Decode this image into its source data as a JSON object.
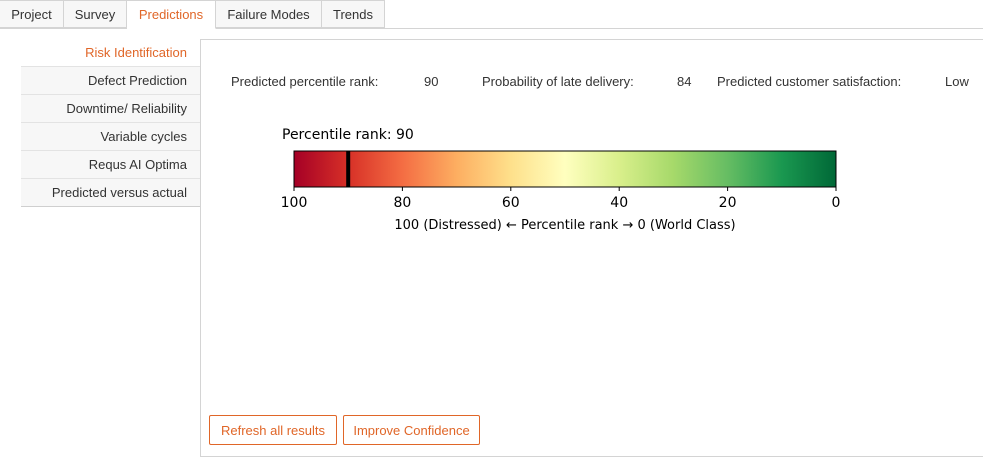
{
  "tabs": [
    {
      "label": "Project"
    },
    {
      "label": "Survey"
    },
    {
      "label": "Predictions"
    },
    {
      "label": "Failure Modes"
    },
    {
      "label": "Trends"
    }
  ],
  "active_tab": "Predictions",
  "sidebar": {
    "items": [
      {
        "label": "Risk Identification"
      },
      {
        "label": "Defect Prediction"
      },
      {
        "label": "Downtime/ Reliability"
      },
      {
        "label": "Variable cycles"
      },
      {
        "label": "Requs AI Optima"
      },
      {
        "label": "Predicted versus actual"
      }
    ],
    "active": "Risk Identification"
  },
  "summary": {
    "percentile_label": "Predicted percentile rank:",
    "percentile_value": "90",
    "late_label": "Probability of late delivery:",
    "late_value": "84",
    "satisfaction_label": "Predicted customer satisfaction:",
    "satisfaction_value": "Low"
  },
  "gauge": {
    "title": "Percentile rank: 90",
    "xlabel": "100 (Distressed) ← Percentile rank → 0 (World Class)",
    "value": 90,
    "range": [
      100,
      0
    ],
    "ticks": [
      "100",
      "80",
      "60",
      "40",
      "20",
      "0"
    ],
    "colormap": [
      "#a50026",
      "#d73027",
      "#f46d43",
      "#fdae61",
      "#fee08b",
      "#ffffbf",
      "#d9ef8b",
      "#a6d96a",
      "#66bd63",
      "#1a9850",
      "#006837"
    ]
  },
  "buttons": {
    "refresh": "Refresh all results",
    "improve": "Improve Confidence"
  },
  "colors": {
    "accent": "#e06628"
  }
}
